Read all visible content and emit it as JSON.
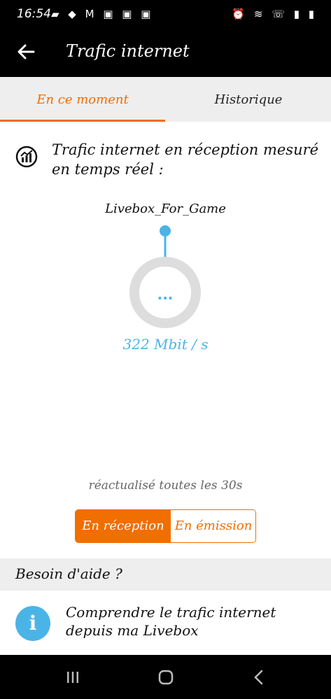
{
  "status_bar": {
    "time": "16:54",
    "left_icons": "▰ ◆ M ▣ ▣ ▣",
    "right_icons": "⏰ ≋ ☏ ▮ ▮"
  },
  "app_bar": {
    "title": "Trafic internet"
  },
  "tabs": [
    {
      "label": "En ce moment",
      "active": true
    },
    {
      "label": "Historique",
      "active": false
    }
  ],
  "realtime": {
    "heading": "Trafic internet en réception mesuré en temps réel :",
    "device_name": "Livebox_For_Game",
    "gauge_center": "...",
    "rate": "322 Mbit / s",
    "refresh_note": "réactualisé toutes les 30s"
  },
  "toggle": {
    "options": [
      "En réception",
      "En émission"
    ],
    "selected": "En réception"
  },
  "help": {
    "header": "Besoin d'aide ?",
    "item_label": "Comprendre le trafic internet depuis ma Livebox"
  },
  "colors": {
    "accent": "#f16e00",
    "blue": "#4bb4e6",
    "gauge_track": "#dddddd"
  }
}
